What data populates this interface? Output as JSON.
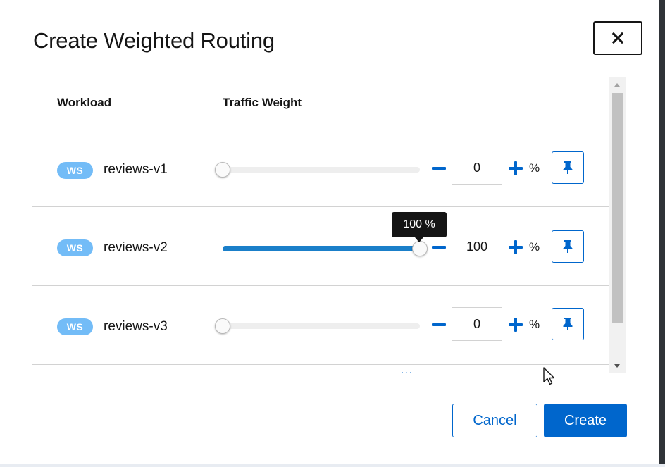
{
  "modal": {
    "title": "Create Weighted Routing",
    "close_icon": "close-icon"
  },
  "table": {
    "headers": {
      "workload": "Workload",
      "weight": "Traffic Weight"
    },
    "rows": [
      {
        "badge": "WS",
        "name": "reviews-v1",
        "value": "0",
        "weight_percent": 0,
        "unit": "%",
        "pin_icon": "pin-icon"
      },
      {
        "badge": "WS",
        "name": "reviews-v2",
        "value": "100",
        "weight_percent": 100,
        "unit": "%",
        "pin_icon": "pin-icon",
        "tooltip": "100 %"
      },
      {
        "badge": "WS",
        "name": "reviews-v3",
        "value": "0",
        "weight_percent": 0,
        "unit": "%",
        "pin_icon": "pin-icon"
      }
    ],
    "more_indicator": "···"
  },
  "footer": {
    "cancel_label": "Cancel",
    "create_label": "Create"
  },
  "colors": {
    "primary": "#0066cc",
    "badge": "#73bcf7",
    "slider_fill": "#1a7fc9",
    "tooltip_bg": "#151515"
  }
}
